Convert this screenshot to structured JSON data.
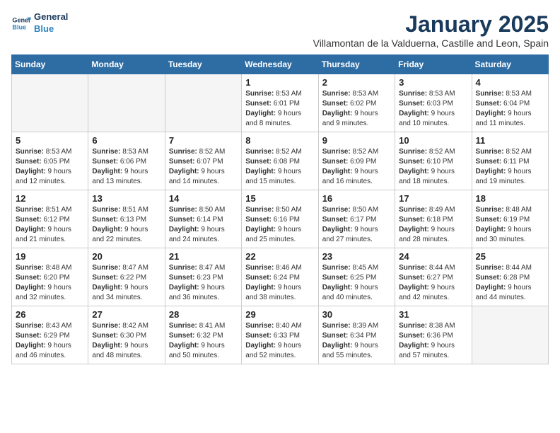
{
  "logo": {
    "line1": "General",
    "line2": "Blue"
  },
  "title": "January 2025",
  "subtitle": "Villamontan de la Valduerna, Castille and Leon, Spain",
  "days_of_week": [
    "Sunday",
    "Monday",
    "Tuesday",
    "Wednesday",
    "Thursday",
    "Friday",
    "Saturday"
  ],
  "weeks": [
    [
      {
        "day": "",
        "info": ""
      },
      {
        "day": "",
        "info": ""
      },
      {
        "day": "",
        "info": ""
      },
      {
        "day": "1",
        "info": "Sunrise: 8:53 AM\nSunset: 6:01 PM\nDaylight: 9 hours and 8 minutes."
      },
      {
        "day": "2",
        "info": "Sunrise: 8:53 AM\nSunset: 6:02 PM\nDaylight: 9 hours and 9 minutes."
      },
      {
        "day": "3",
        "info": "Sunrise: 8:53 AM\nSunset: 6:03 PM\nDaylight: 9 hours and 10 minutes."
      },
      {
        "day": "4",
        "info": "Sunrise: 8:53 AM\nSunset: 6:04 PM\nDaylight: 9 hours and 11 minutes."
      }
    ],
    [
      {
        "day": "5",
        "info": "Sunrise: 8:53 AM\nSunset: 6:05 PM\nDaylight: 9 hours and 12 minutes."
      },
      {
        "day": "6",
        "info": "Sunrise: 8:53 AM\nSunset: 6:06 PM\nDaylight: 9 hours and 13 minutes."
      },
      {
        "day": "7",
        "info": "Sunrise: 8:52 AM\nSunset: 6:07 PM\nDaylight: 9 hours and 14 minutes."
      },
      {
        "day": "8",
        "info": "Sunrise: 8:52 AM\nSunset: 6:08 PM\nDaylight: 9 hours and 15 minutes."
      },
      {
        "day": "9",
        "info": "Sunrise: 8:52 AM\nSunset: 6:09 PM\nDaylight: 9 hours and 16 minutes."
      },
      {
        "day": "10",
        "info": "Sunrise: 8:52 AM\nSunset: 6:10 PM\nDaylight: 9 hours and 18 minutes."
      },
      {
        "day": "11",
        "info": "Sunrise: 8:52 AM\nSunset: 6:11 PM\nDaylight: 9 hours and 19 minutes."
      }
    ],
    [
      {
        "day": "12",
        "info": "Sunrise: 8:51 AM\nSunset: 6:12 PM\nDaylight: 9 hours and 21 minutes."
      },
      {
        "day": "13",
        "info": "Sunrise: 8:51 AM\nSunset: 6:13 PM\nDaylight: 9 hours and 22 minutes."
      },
      {
        "day": "14",
        "info": "Sunrise: 8:50 AM\nSunset: 6:14 PM\nDaylight: 9 hours and 24 minutes."
      },
      {
        "day": "15",
        "info": "Sunrise: 8:50 AM\nSunset: 6:16 PM\nDaylight: 9 hours and 25 minutes."
      },
      {
        "day": "16",
        "info": "Sunrise: 8:50 AM\nSunset: 6:17 PM\nDaylight: 9 hours and 27 minutes."
      },
      {
        "day": "17",
        "info": "Sunrise: 8:49 AM\nSunset: 6:18 PM\nDaylight: 9 hours and 28 minutes."
      },
      {
        "day": "18",
        "info": "Sunrise: 8:48 AM\nSunset: 6:19 PM\nDaylight: 9 hours and 30 minutes."
      }
    ],
    [
      {
        "day": "19",
        "info": "Sunrise: 8:48 AM\nSunset: 6:20 PM\nDaylight: 9 hours and 32 minutes."
      },
      {
        "day": "20",
        "info": "Sunrise: 8:47 AM\nSunset: 6:22 PM\nDaylight: 9 hours and 34 minutes."
      },
      {
        "day": "21",
        "info": "Sunrise: 8:47 AM\nSunset: 6:23 PM\nDaylight: 9 hours and 36 minutes."
      },
      {
        "day": "22",
        "info": "Sunrise: 8:46 AM\nSunset: 6:24 PM\nDaylight: 9 hours and 38 minutes."
      },
      {
        "day": "23",
        "info": "Sunrise: 8:45 AM\nSunset: 6:25 PM\nDaylight: 9 hours and 40 minutes."
      },
      {
        "day": "24",
        "info": "Sunrise: 8:44 AM\nSunset: 6:27 PM\nDaylight: 9 hours and 42 minutes."
      },
      {
        "day": "25",
        "info": "Sunrise: 8:44 AM\nSunset: 6:28 PM\nDaylight: 9 hours and 44 minutes."
      }
    ],
    [
      {
        "day": "26",
        "info": "Sunrise: 8:43 AM\nSunset: 6:29 PM\nDaylight: 9 hours and 46 minutes."
      },
      {
        "day": "27",
        "info": "Sunrise: 8:42 AM\nSunset: 6:30 PM\nDaylight: 9 hours and 48 minutes."
      },
      {
        "day": "28",
        "info": "Sunrise: 8:41 AM\nSunset: 6:32 PM\nDaylight: 9 hours and 50 minutes."
      },
      {
        "day": "29",
        "info": "Sunrise: 8:40 AM\nSunset: 6:33 PM\nDaylight: 9 hours and 52 minutes."
      },
      {
        "day": "30",
        "info": "Sunrise: 8:39 AM\nSunset: 6:34 PM\nDaylight: 9 hours and 55 minutes."
      },
      {
        "day": "31",
        "info": "Sunrise: 8:38 AM\nSunset: 6:36 PM\nDaylight: 9 hours and 57 minutes."
      },
      {
        "day": "",
        "info": ""
      }
    ]
  ]
}
